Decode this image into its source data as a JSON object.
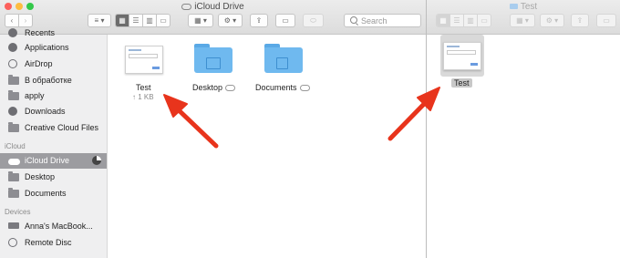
{
  "window_main": {
    "title": "iCloud Drive",
    "search_placeholder": "Search",
    "sidebar": {
      "top_items": [
        {
          "label": "Recents"
        },
        {
          "label": "Applications"
        },
        {
          "label": "AirDrop"
        },
        {
          "label": "В обработке"
        },
        {
          "label": "apply"
        },
        {
          "label": "Downloads"
        },
        {
          "label": "Creative Cloud Files"
        }
      ],
      "icloud_header": "iCloud",
      "icloud_items": [
        {
          "label": "iCloud Drive"
        },
        {
          "label": "Desktop"
        },
        {
          "label": "Documents"
        }
      ],
      "devices_header": "Devices",
      "device_items": [
        {
          "label": "Anna's MacBook..."
        },
        {
          "label": "Remote Disc"
        }
      ]
    },
    "files": [
      {
        "name": "Test",
        "size": "↑ 1 KB"
      },
      {
        "name": "Desktop"
      },
      {
        "name": "Documents"
      }
    ]
  },
  "window_second": {
    "title": "Test",
    "file": {
      "name": "Test"
    }
  },
  "colors": {
    "arrow": "#e8341c",
    "selection": "#9c9ca0",
    "folder": "#6fb9ef",
    "close": "#fc605c",
    "minimize": "#fdbc40",
    "zoom": "#34c84a"
  }
}
